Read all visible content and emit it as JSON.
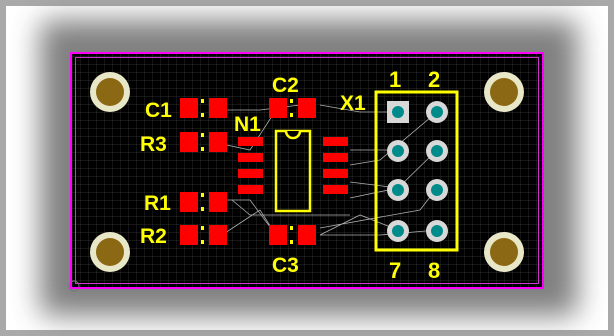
{
  "colors": {
    "board": "#000000",
    "outline": "#ff00ff",
    "pad": "#ff0000",
    "silkscreen": "#ffff00",
    "mounting_hole": "#8b6914",
    "through_hole_pad": "#008b8b",
    "trace": "#c0c0c0",
    "grid": "#3a3a3a"
  },
  "labels": {
    "C1": "C1",
    "C2": "C2",
    "C3": "C3",
    "R1": "R1",
    "R2": "R2",
    "R3": "R3",
    "N1": "N1",
    "X1": "X1",
    "pin1": "1",
    "pin2": "2",
    "pin7": "7",
    "pin8": "8"
  }
}
